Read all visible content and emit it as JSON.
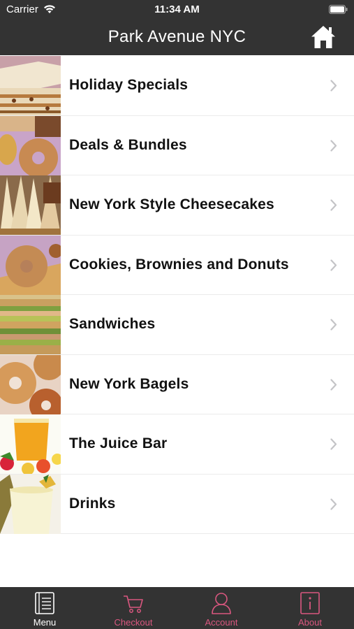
{
  "status_bar": {
    "carrier": "Carrier",
    "time": "11:34 AM"
  },
  "header": {
    "title": "Park Avenue NYC"
  },
  "menu": {
    "items": [
      {
        "label": "Holiday Specials",
        "icon": "cake-slice-image"
      },
      {
        "label": "Deals & Bundles",
        "icon": "donut-image"
      },
      {
        "label": "New York Style Cheesecakes",
        "icon": "cheesecake-image"
      },
      {
        "label": "Cookies, Brownies and Donuts",
        "icon": "donut-image"
      },
      {
        "label": "Sandwiches",
        "icon": "sandwich-image"
      },
      {
        "label": "New York Bagels",
        "icon": "bagel-image"
      },
      {
        "label": "The Juice Bar",
        "icon": "juice-image"
      },
      {
        "label": "Drinks",
        "icon": "drink-image"
      }
    ]
  },
  "tabs": [
    {
      "label": "Menu",
      "icon": "menu-book-icon",
      "active": true
    },
    {
      "label": "Checkout",
      "icon": "cart-icon",
      "active": false
    },
    {
      "label": "Account",
      "icon": "user-icon",
      "active": false
    },
    {
      "label": "About",
      "icon": "info-icon",
      "active": false
    }
  ],
  "colors": {
    "bar": "#333333",
    "accent": "#d9577f",
    "active_tab": "#ffffff"
  }
}
